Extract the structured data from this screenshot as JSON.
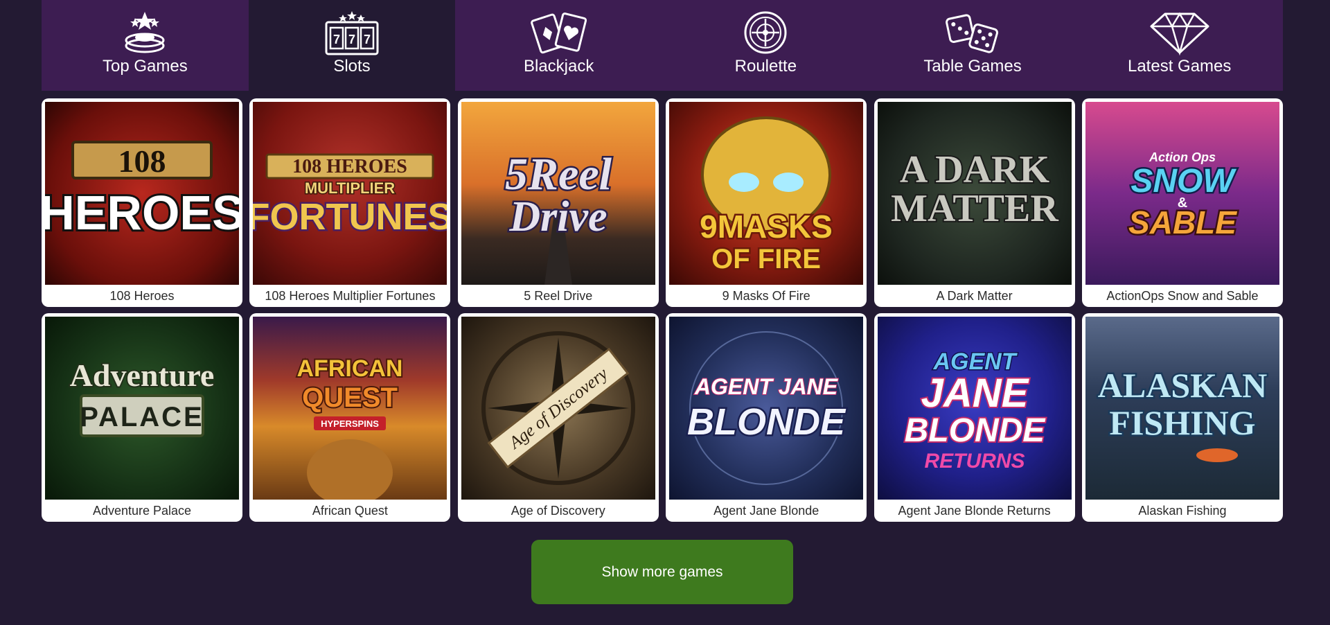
{
  "tabs": [
    {
      "label": "Top Games",
      "icon": "top-games-icon",
      "active": false
    },
    {
      "label": "Slots",
      "icon": "slot-machine-icon",
      "active": true
    },
    {
      "label": "Blackjack",
      "icon": "playing-cards-icon",
      "active": false
    },
    {
      "label": "Roulette",
      "icon": "roulette-wheel-icon",
      "active": false
    },
    {
      "label": "Table Games",
      "icon": "dice-icon",
      "active": false
    },
    {
      "label": "Latest Games",
      "icon": "diamond-icon",
      "active": false
    }
  ],
  "games": [
    {
      "title": "108 Heroes",
      "logo_lines": [
        "108",
        "HEROES"
      ]
    },
    {
      "title": "108 Heroes Multiplier Fortunes",
      "logo_lines": [
        "108 HEROES",
        "MULTIPLIER",
        "FORTUNES"
      ]
    },
    {
      "title": "5 Reel Drive",
      "logo_lines": [
        "5Reel",
        "Drive"
      ]
    },
    {
      "title": "9 Masks Of Fire",
      "logo_lines": [
        "9MASKS",
        "OF FIRE"
      ]
    },
    {
      "title": "A Dark Matter",
      "logo_lines": [
        "A DARK",
        "MATTER"
      ]
    },
    {
      "title": "ActionOps Snow and Sable",
      "logo_lines": [
        "Action Ops",
        "SNOW",
        "&",
        "SABLE"
      ]
    },
    {
      "title": "Adventure Palace",
      "logo_lines": [
        "Adventure",
        "PALACE"
      ]
    },
    {
      "title": "African Quest",
      "logo_lines": [
        "AFRICAN",
        "QUEST",
        "HYPERSPINS"
      ]
    },
    {
      "title": "Age of Discovery",
      "logo_lines": [
        "Age of Discovery"
      ]
    },
    {
      "title": "Agent Jane Blonde",
      "logo_lines": [
        "AGENT JANE",
        "BLONDE"
      ]
    },
    {
      "title": "Agent Jane Blonde Returns",
      "logo_lines": [
        "AGENT",
        "JANE",
        "BLONDE",
        "RETURNS"
      ]
    },
    {
      "title": "Alaskan Fishing",
      "logo_lines": [
        "ALASKAN",
        "FISHING"
      ]
    }
  ],
  "show_more": {
    "label": "Show more games"
  },
  "colors": {
    "page_bg": "#231a33",
    "tab_bar": "#3d1d52",
    "button": "#3e7a1e"
  }
}
